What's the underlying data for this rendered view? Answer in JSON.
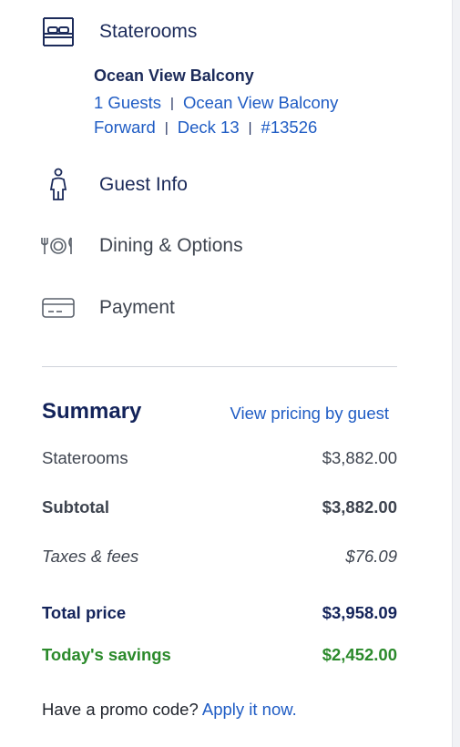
{
  "steps": {
    "staterooms": {
      "label": "Staterooms",
      "icon": "bed-icon",
      "details": {
        "room_type": "Ocean View Balcony",
        "guests": "1 Guests",
        "category": "Ocean View Balcony",
        "location": "Forward",
        "deck": "Deck 13",
        "room_number": "#13526"
      }
    },
    "guest_info": {
      "label": "Guest Info",
      "icon": "person-icon"
    },
    "dining": {
      "label": "Dining & Options",
      "icon": "dining-icon"
    },
    "payment": {
      "label": "Payment",
      "icon": "credit-card-icon"
    }
  },
  "summary": {
    "title": "Summary",
    "pricing_link": "View pricing by guest",
    "rows": [
      {
        "label": "Staterooms",
        "value": "$3,882.00"
      },
      {
        "label": "Subtotal",
        "value": "$3,882.00"
      },
      {
        "label": "Taxes & fees",
        "value": "$76.09"
      },
      {
        "label": "Total price",
        "value": "$3,958.09"
      },
      {
        "label": "Today's savings",
        "value": "$2,452.00"
      }
    ]
  },
  "promo": {
    "text": "Have a promo code?",
    "link": "Apply it now."
  },
  "colors": {
    "navy": "#13235a",
    "link_blue": "#1f5cc4",
    "savings_green": "#2b8a2b",
    "muted_text": "#3f4550"
  }
}
